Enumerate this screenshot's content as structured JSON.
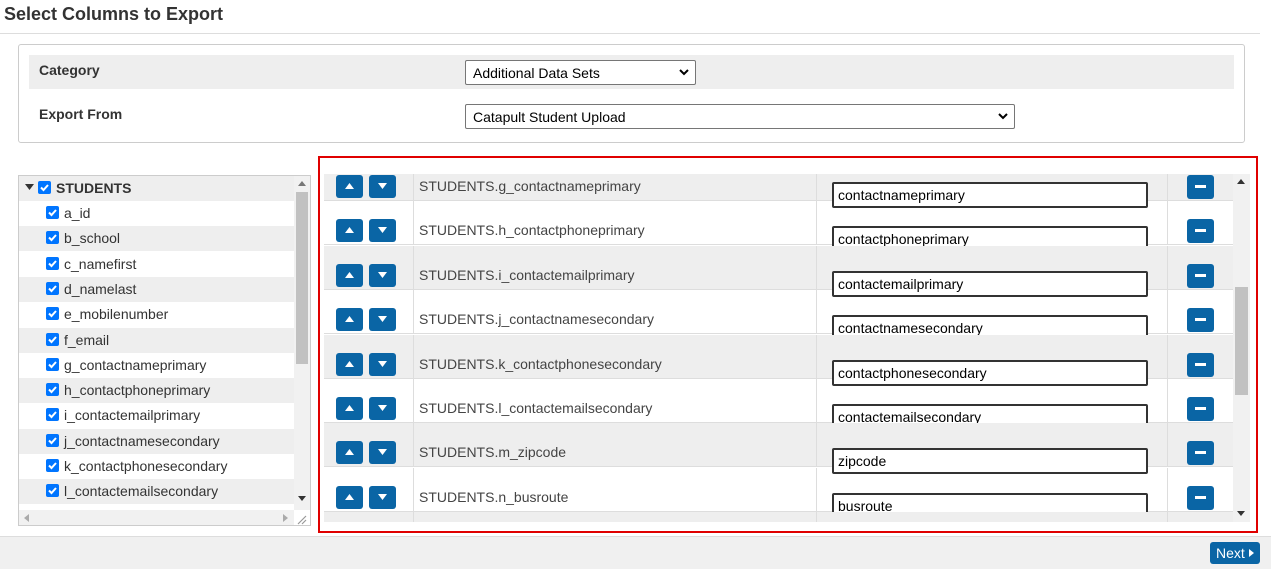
{
  "page": {
    "title": "Select Columns to Export"
  },
  "filters": {
    "category_label": "Category",
    "category_value": "Additional Data Sets",
    "export_from_label": "Export From",
    "export_from_value": "Catapult Student Upload"
  },
  "tree": {
    "root": {
      "label": "STUDENTS",
      "checked": true,
      "expanded": true
    },
    "items": [
      {
        "label": "a_id",
        "checked": true
      },
      {
        "label": "b_school",
        "checked": true
      },
      {
        "label": "c_namefirst",
        "checked": true
      },
      {
        "label": "d_namelast",
        "checked": true
      },
      {
        "label": "e_mobilenumber",
        "checked": true
      },
      {
        "label": "f_email",
        "checked": true
      },
      {
        "label": "g_contactnameprimary",
        "checked": true
      },
      {
        "label": "h_contactphoneprimary",
        "checked": true
      },
      {
        "label": "i_contactemailprimary",
        "checked": true
      },
      {
        "label": "j_contactnamesecondary",
        "checked": true
      },
      {
        "label": "k_contactphonesecondary",
        "checked": true
      },
      {
        "label": "l_contactemailsecondary",
        "checked": true
      }
    ]
  },
  "columns": [
    {
      "source": "STUDENTS.g_contactnameprimary",
      "export_name": "contactnameprimary"
    },
    {
      "source": "STUDENTS.h_contactphoneprimary",
      "export_name": "contactphoneprimary"
    },
    {
      "source": "STUDENTS.i_contactemailprimary",
      "export_name": "contactemailprimary"
    },
    {
      "source": "STUDENTS.j_contactnamesecondary",
      "export_name": "contactnamesecondary"
    },
    {
      "source": "STUDENTS.k_contactphonesecondary",
      "export_name": "contactphonesecondary"
    },
    {
      "source": "STUDENTS.l_contactemailsecondary",
      "export_name": "contactemailsecondary"
    },
    {
      "source": "STUDENTS.m_zipcode",
      "export_name": "zipcode"
    },
    {
      "source": "STUDENTS.n_busroute",
      "export_name": "busroute"
    }
  ],
  "footer": {
    "next_label": "Next"
  },
  "colors": {
    "button_blue": "#0a65a5",
    "highlight_border": "#e00000",
    "checkbox_blue": "#0075ff",
    "row_shade": "#eeeeee"
  },
  "icons": {
    "move_up": "caret-up-icon",
    "move_down": "caret-down-icon",
    "remove": "minus-icon",
    "next": "caret-right-icon",
    "tree_toggle": "caret-down-icon",
    "checkbox": "check-icon"
  }
}
